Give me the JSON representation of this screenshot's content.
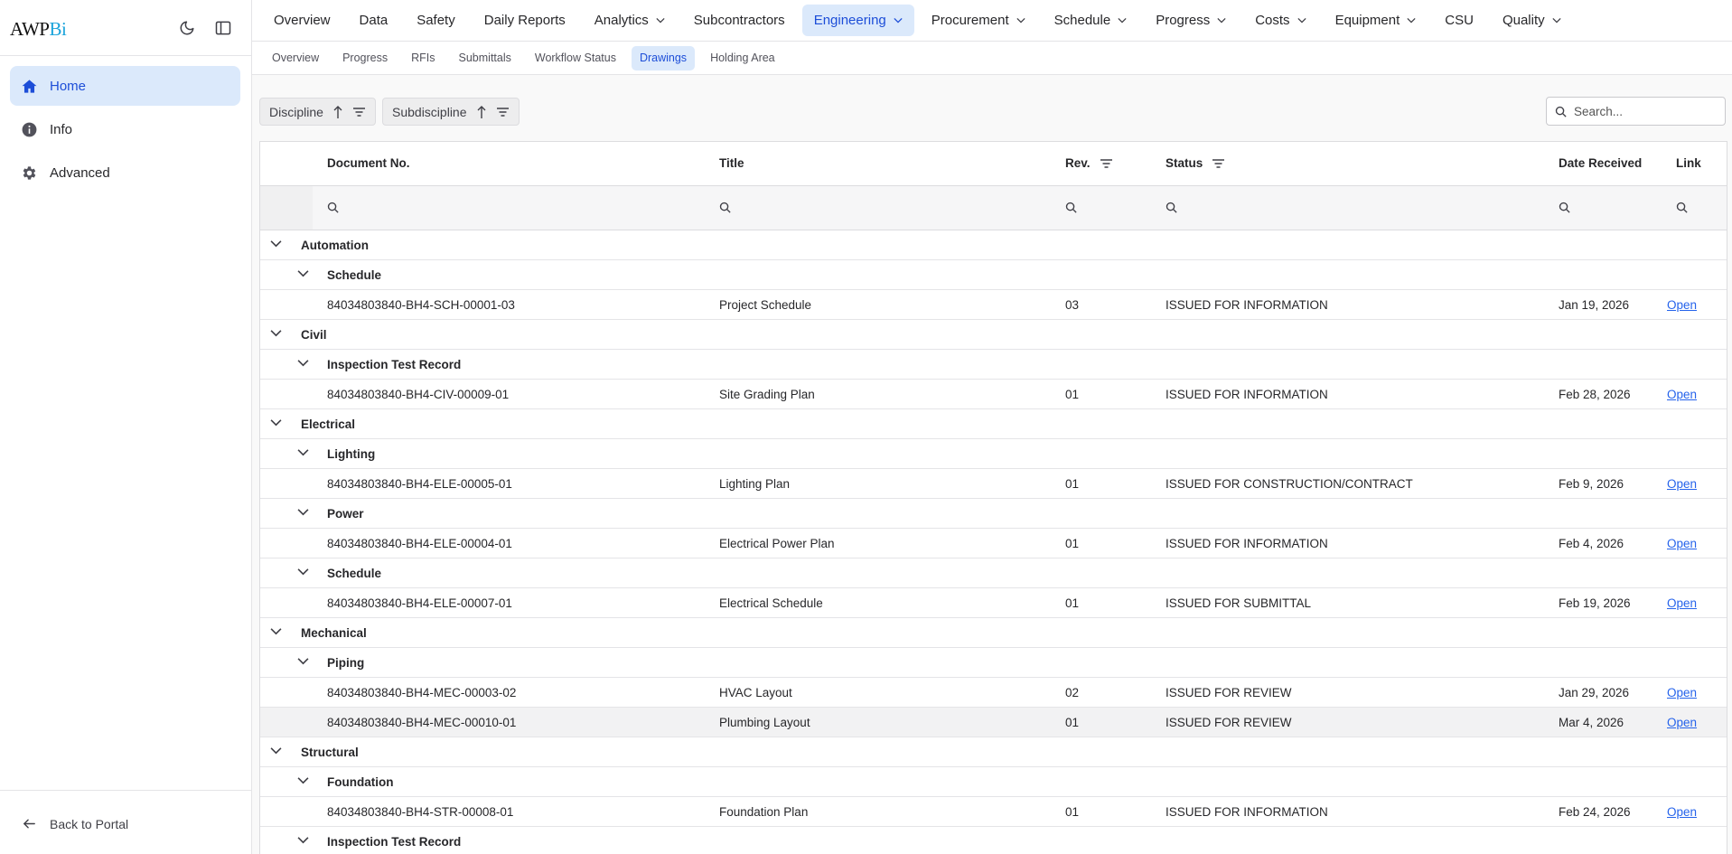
{
  "brand": {
    "logo_main": "AWP",
    "logo_accent": "Bi"
  },
  "sidebar": {
    "items": [
      {
        "label": "Home",
        "icon": "home-icon"
      },
      {
        "label": "Info",
        "icon": "info-icon"
      },
      {
        "label": "Advanced",
        "icon": "gear-icon"
      }
    ],
    "footer_label": "Back to Portal"
  },
  "top_nav": [
    {
      "label": "Overview"
    },
    {
      "label": "Data"
    },
    {
      "label": "Safety"
    },
    {
      "label": "Daily Reports"
    },
    {
      "label": "Analytics",
      "dropdown": true
    },
    {
      "label": "Subcontractors"
    },
    {
      "label": "Engineering",
      "dropdown": true,
      "active": true
    },
    {
      "label": "Procurement",
      "dropdown": true
    },
    {
      "label": "Schedule",
      "dropdown": true
    },
    {
      "label": "Progress",
      "dropdown": true
    },
    {
      "label": "Costs",
      "dropdown": true
    },
    {
      "label": "Equipment",
      "dropdown": true
    },
    {
      "label": "CSU"
    },
    {
      "label": "Quality",
      "dropdown": true
    }
  ],
  "sub_nav": [
    {
      "label": "Overview"
    },
    {
      "label": "Progress"
    },
    {
      "label": "RFIs"
    },
    {
      "label": "Submittals"
    },
    {
      "label": "Workflow Status"
    },
    {
      "label": "Drawings",
      "active": true
    },
    {
      "label": "Holding Area"
    }
  ],
  "group_chips": [
    {
      "label": "Discipline"
    },
    {
      "label": "Subdiscipline"
    }
  ],
  "search": {
    "placeholder": "Search..."
  },
  "table": {
    "columns": {
      "doc_no": "Document No.",
      "title": "Title",
      "rev": "Rev.",
      "status": "Status",
      "date": "Date Received",
      "link": "Link"
    },
    "link_label": "Open",
    "rows": [
      {
        "type": "discipline",
        "label": "Automation"
      },
      {
        "type": "subdiscipline",
        "label": "Schedule"
      },
      {
        "type": "doc",
        "doc_no": "84034803840-BH4-SCH-00001-03",
        "title": "Project Schedule",
        "rev": "03",
        "status": "ISSUED FOR INFORMATION",
        "date": "Jan 19, 2026"
      },
      {
        "type": "discipline",
        "label": "Civil"
      },
      {
        "type": "subdiscipline",
        "label": "Inspection Test Record"
      },
      {
        "type": "doc",
        "doc_no": "84034803840-BH4-CIV-00009-01",
        "title": "Site Grading Plan",
        "rev": "01",
        "status": "ISSUED FOR INFORMATION",
        "date": "Feb 28, 2026"
      },
      {
        "type": "discipline",
        "label": "Electrical"
      },
      {
        "type": "subdiscipline",
        "label": "Lighting"
      },
      {
        "type": "doc",
        "doc_no": "84034803840-BH4-ELE-00005-01",
        "title": "Lighting Plan",
        "rev": "01",
        "status": "ISSUED FOR CONSTRUCTION/CONTRACT",
        "date": "Feb 9, 2026"
      },
      {
        "type": "subdiscipline",
        "label": "Power"
      },
      {
        "type": "doc",
        "doc_no": "84034803840-BH4-ELE-00004-01",
        "title": "Electrical Power Plan",
        "rev": "01",
        "status": "ISSUED FOR INFORMATION",
        "date": "Feb 4, 2026"
      },
      {
        "type": "subdiscipline",
        "label": "Schedule"
      },
      {
        "type": "doc",
        "doc_no": "84034803840-BH4-ELE-00007-01",
        "title": "Electrical Schedule",
        "rev": "01",
        "status": "ISSUED FOR SUBMITTAL",
        "date": "Feb 19, 2026"
      },
      {
        "type": "discipline",
        "label": "Mechanical"
      },
      {
        "type": "subdiscipline",
        "label": "Piping"
      },
      {
        "type": "doc",
        "doc_no": "84034803840-BH4-MEC-00003-02",
        "title": "HVAC Layout",
        "rev": "02",
        "status": "ISSUED FOR REVIEW",
        "date": "Jan 29, 2026"
      },
      {
        "type": "doc",
        "doc_no": "84034803840-BH4-MEC-00010-01",
        "title": "Plumbing Layout",
        "rev": "01",
        "status": "ISSUED FOR REVIEW",
        "date": "Mar 4, 2026",
        "highlighted": true
      },
      {
        "type": "discipline",
        "label": "Structural"
      },
      {
        "type": "subdiscipline",
        "label": "Foundation"
      },
      {
        "type": "doc",
        "doc_no": "84034803840-BH4-STR-00008-01",
        "title": "Foundation Plan",
        "rev": "01",
        "status": "ISSUED FOR INFORMATION",
        "date": "Feb 24, 2026"
      },
      {
        "type": "subdiscipline",
        "label": "Inspection Test Record"
      }
    ]
  },
  "colors": {
    "accent": "#1d4ed8",
    "accent_bg": "#dbe9fb",
    "link": "#2563eb",
    "logo_accent": "#1aa3db"
  }
}
